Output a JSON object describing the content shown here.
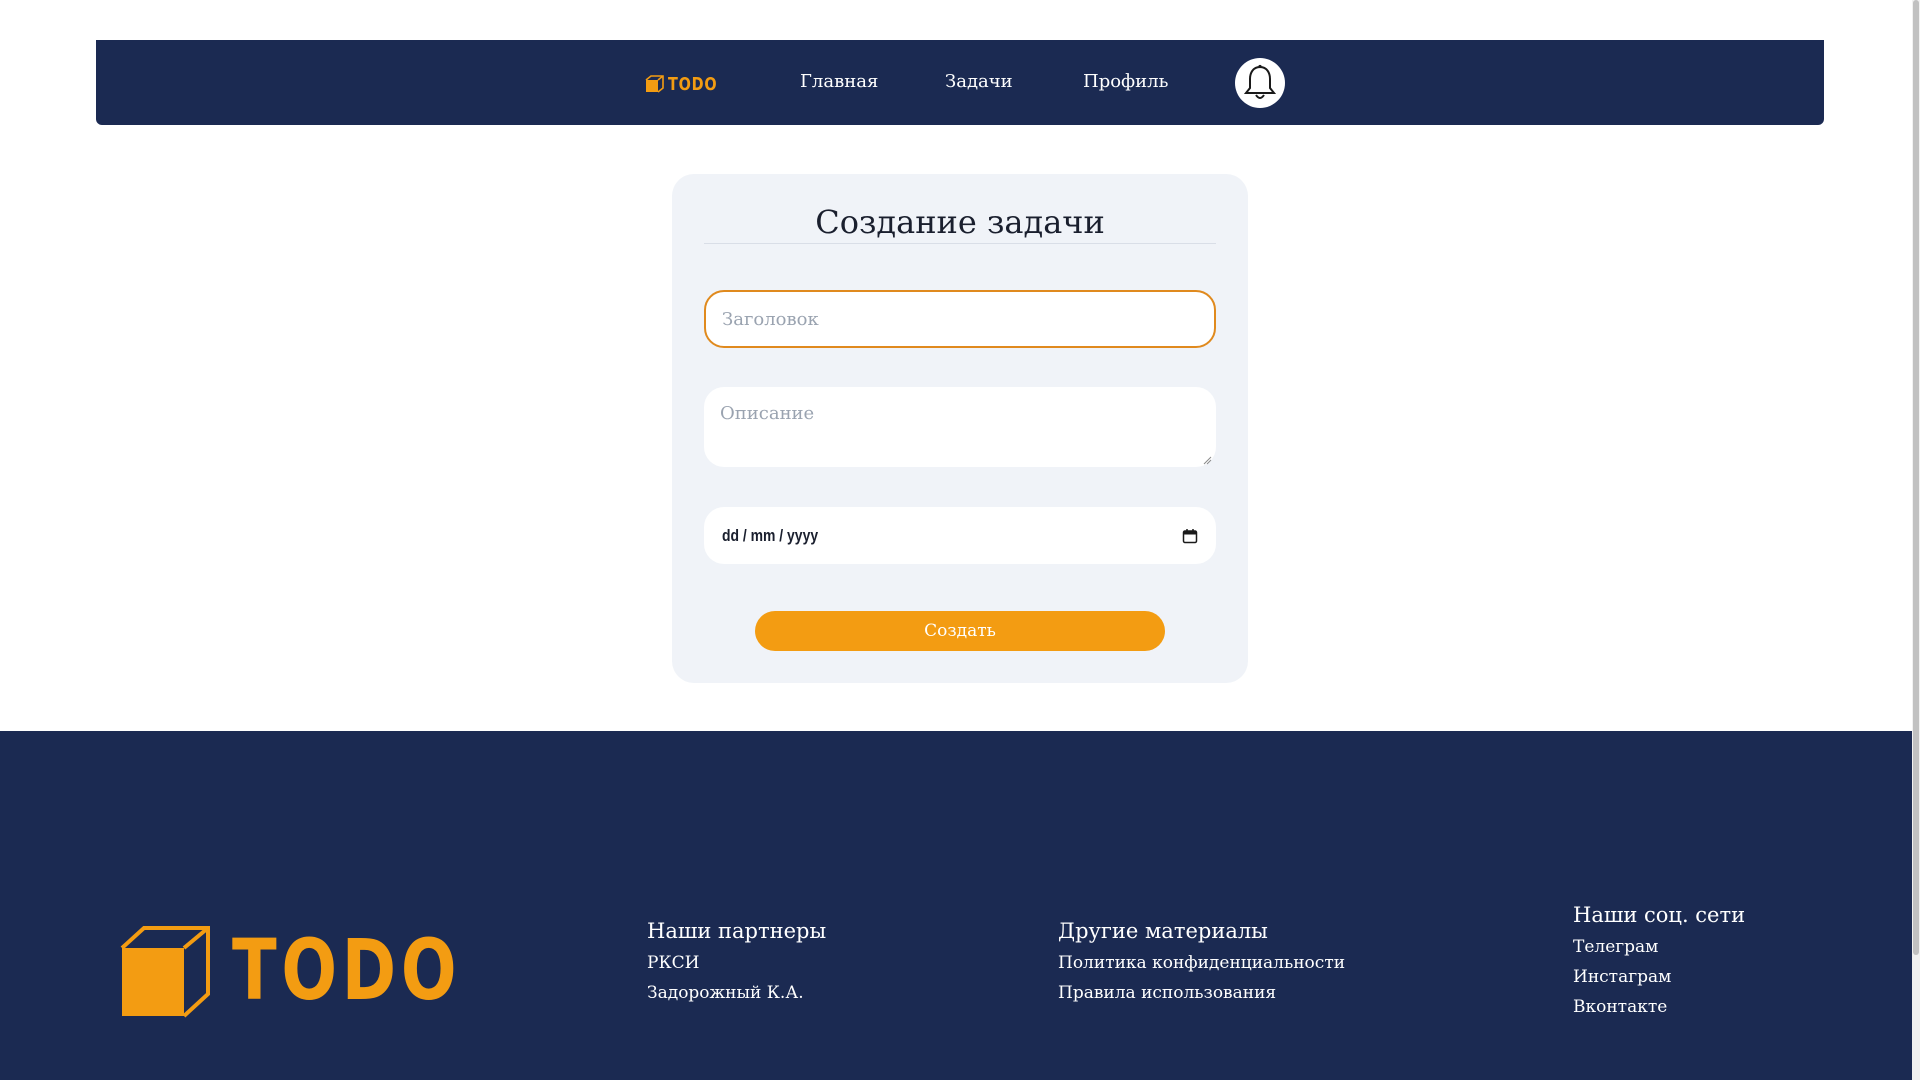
{
  "header": {
    "logo_text": "TODO",
    "nav": [
      {
        "label": "Главная"
      },
      {
        "label": "Задачи"
      },
      {
        "label": "Профиль"
      }
    ],
    "notification_icon": "bell-icon"
  },
  "form": {
    "title": "Создание задачи",
    "title_placeholder": "Заголовок",
    "description_placeholder": "Описание",
    "date_placeholder": "dd / mm / yyyy",
    "submit_label": "Создать"
  },
  "footer": {
    "logo_text": "TODO",
    "partners": {
      "heading": "Наши партнеры",
      "links": [
        "РКСИ",
        "Задорожный К.А."
      ]
    },
    "materials": {
      "heading": "Другие материалы",
      "links": [
        "Политика конфиденциальности",
        "Правила использования"
      ]
    },
    "social": {
      "heading": "Наши соц. сети",
      "links": [
        "Телеграм",
        "Инстаграм",
        "Вконтакте"
      ]
    }
  },
  "colors": {
    "navy": "#1b2a52",
    "accent": "#f39c12",
    "card_bg": "#f0f3f8"
  }
}
